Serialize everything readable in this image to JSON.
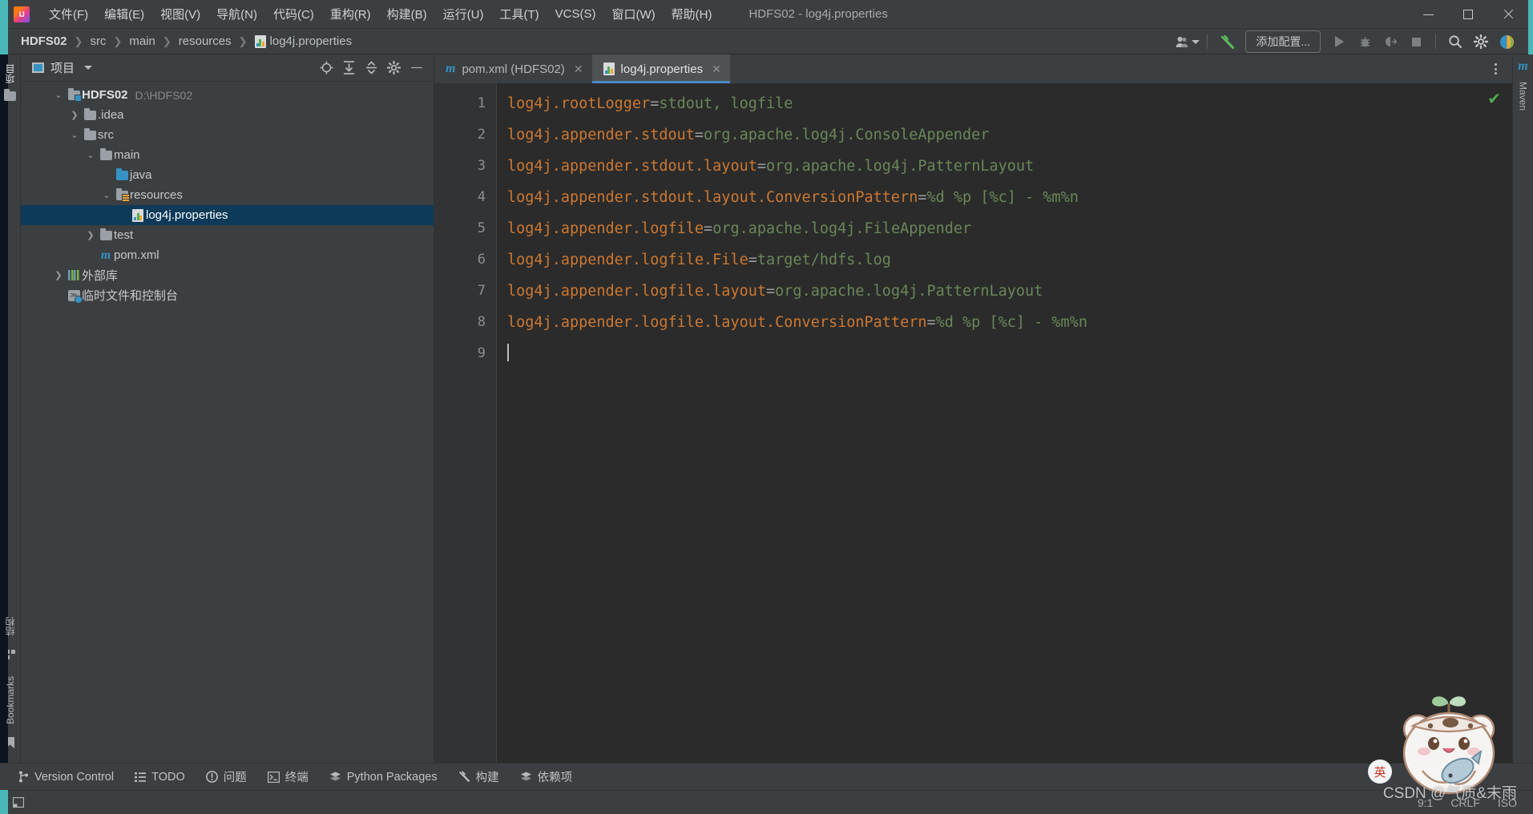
{
  "window": {
    "title": "HDFS02 - log4j.properties",
    "minimize_label": "—",
    "maximize_label": "□",
    "close_label": "✕"
  },
  "menubar": {
    "items": [
      {
        "label": "文件(F)",
        "mnemonic": "F"
      },
      {
        "label": "编辑(E)",
        "mnemonic": "E"
      },
      {
        "label": "视图(V)",
        "mnemonic": "V"
      },
      {
        "label": "导航(N)",
        "mnemonic": "N"
      },
      {
        "label": "代码(C)",
        "mnemonic": "C"
      },
      {
        "label": "重构(R)",
        "mnemonic": "R"
      },
      {
        "label": "构建(B)",
        "mnemonic": "B"
      },
      {
        "label": "运行(U)",
        "mnemonic": "U"
      },
      {
        "label": "工具(T)",
        "mnemonic": "T"
      },
      {
        "label": "VCS(S)",
        "mnemonic": "S"
      },
      {
        "label": "窗口(W)",
        "mnemonic": "W"
      },
      {
        "label": "帮助(H)",
        "mnemonic": "H"
      }
    ]
  },
  "navbar": {
    "breadcrumbs": [
      {
        "label": "HDFS02",
        "icon": ""
      },
      {
        "label": "src",
        "icon": ""
      },
      {
        "label": "main",
        "icon": ""
      },
      {
        "label": "resources",
        "icon": ""
      },
      {
        "label": "log4j.properties",
        "icon": "properties-file-icon"
      }
    ],
    "separator": "❯",
    "toolbar": {
      "run_config_label": "添加配置...",
      "search_glyph": "🔍",
      "settings_glyph": "⚙",
      "run_tooltip": "运行",
      "debug_tooltip": "调试",
      "coverage_tooltip": "运行覆盖率",
      "stop_tooltip": "停止"
    }
  },
  "left_strip": {
    "top_label": "项目",
    "bottom_items": [
      {
        "label": "结构"
      },
      {
        "label": "Bookmarks"
      }
    ]
  },
  "right_strip": {
    "items": [
      {
        "label": "Maven",
        "icon": "maven-icon"
      }
    ]
  },
  "project_pane": {
    "title": "项目",
    "actions": [
      {
        "name": "select-opened-file",
        "glyph": "⊕"
      },
      {
        "name": "expand-all",
        "glyph": "⤓"
      },
      {
        "name": "collapse-all",
        "glyph": "⤒"
      },
      {
        "name": "settings",
        "glyph": "⚙"
      },
      {
        "name": "hide",
        "glyph": "—"
      }
    ],
    "tree": [
      {
        "label": "HDFS02",
        "path": "D:\\HDFS02",
        "indent": 0,
        "arrow": "v",
        "icon": "project-folder-icon",
        "bold": true,
        "selected": false
      },
      {
        "label": ".idea",
        "path": "",
        "indent": 1,
        "arrow": ">",
        "icon": "folder-icon",
        "bold": false,
        "selected": false
      },
      {
        "label": "src",
        "path": "",
        "indent": 1,
        "arrow": "v",
        "icon": "folder-icon",
        "bold": false,
        "selected": false
      },
      {
        "label": "main",
        "path": "",
        "indent": 2,
        "arrow": "v",
        "icon": "folder-icon",
        "bold": false,
        "selected": false
      },
      {
        "label": "java",
        "path": "",
        "indent": 3,
        "arrow": "",
        "icon": "source-folder-icon",
        "bold": false,
        "selected": false
      },
      {
        "label": "resources",
        "path": "",
        "indent": 3,
        "arrow": "v",
        "icon": "resources-folder-icon",
        "bold": false,
        "selected": false
      },
      {
        "label": "log4j.properties",
        "path": "",
        "indent": 4,
        "arrow": "",
        "icon": "properties-file-icon",
        "bold": false,
        "selected": true
      },
      {
        "label": "test",
        "path": "",
        "indent": 2,
        "arrow": ">",
        "icon": "folder-icon",
        "bold": false,
        "selected": false
      },
      {
        "label": "pom.xml",
        "path": "",
        "indent": 2,
        "arrow": "",
        "icon": "maven-pom-icon",
        "bold": false,
        "selected": false
      },
      {
        "label": "外部库",
        "path": "",
        "indent": 0,
        "arrow": ">",
        "icon": "library-icon",
        "bold": false,
        "selected": false
      },
      {
        "label": "临时文件和控制台",
        "path": "",
        "indent": 0,
        "arrow": "",
        "icon": "scratches-icon",
        "bold": false,
        "selected": false
      }
    ]
  },
  "editor": {
    "tabs": [
      {
        "label": "pom.xml (HDFS02)",
        "icon": "maven-pom-icon",
        "active": false,
        "close": "✕"
      },
      {
        "label": "log4j.properties",
        "icon": "properties-file-icon",
        "active": true,
        "close": "✕"
      }
    ],
    "inspection_status": "✔",
    "lines": [
      {
        "no": "1",
        "key": "log4j.rootLogger",
        "eq": "=",
        "value": "stdout, logfile"
      },
      {
        "no": "2",
        "key": "log4j.appender.stdout",
        "eq": "=",
        "value": "org.apache.log4j.ConsoleAppender"
      },
      {
        "no": "3",
        "key": "log4j.appender.stdout.layout",
        "eq": "=",
        "value": "org.apache.log4j.PatternLayout"
      },
      {
        "no": "4",
        "key": "log4j.appender.stdout.layout.ConversionPattern",
        "eq": "=",
        "value": "%d %p [%c] - %m%n"
      },
      {
        "no": "5",
        "key": "log4j.appender.logfile",
        "eq": "=",
        "value": "org.apache.log4j.FileAppender"
      },
      {
        "no": "6",
        "key": "log4j.appender.logfile.File",
        "eq": "=",
        "value": "target/hdfs.log"
      },
      {
        "no": "7",
        "key": "log4j.appender.logfile.layout",
        "eq": "=",
        "value": "org.apache.log4j.PatternLayout"
      },
      {
        "no": "8",
        "key": "log4j.appender.logfile.layout.ConversionPattern",
        "eq": "=",
        "value": "%d %p [%c] - %m%n"
      },
      {
        "no": "9",
        "key": "",
        "eq": "",
        "value": ""
      }
    ]
  },
  "bottom_bar": {
    "items": [
      {
        "label": "Version Control",
        "glyph": "⑂"
      },
      {
        "label": "TODO",
        "glyph": "☰"
      },
      {
        "label": "问题",
        "glyph": "❗"
      },
      {
        "label": "终端",
        "glyph": "▣"
      },
      {
        "label": "Python Packages",
        "glyph": "❧"
      },
      {
        "label": "构建",
        "glyph": "🔨"
      },
      {
        "label": "依赖项",
        "glyph": "❧"
      }
    ]
  },
  "status_bar": {
    "caret_position": "9:1",
    "line_separator": "CRLF",
    "encoding": "ISO",
    "left_glyph": "▣"
  },
  "watermark": {
    "text": "CSDN @气质&末雨",
    "ime_badge": "英"
  },
  "colors": {
    "accent_teal": "#4ab8b8",
    "tab_underline": "#4a88c7",
    "selection_blue": "#0d3a58",
    "syntax_key": "#cc7832",
    "syntax_value": "#6a8759",
    "ok_green": "#4faa4f",
    "panel_bg": "#3c3f41",
    "editor_bg": "#2b2b2b",
    "gutter_bg": "#313335"
  }
}
